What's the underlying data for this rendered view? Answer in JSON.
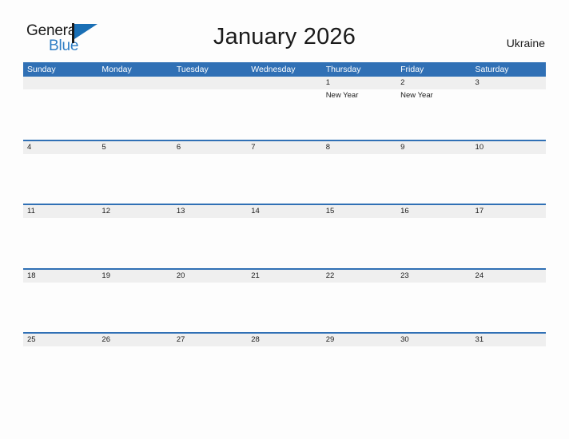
{
  "brand": {
    "name_part1": "General",
    "name_part2": "Blue",
    "logo_icon": "general-blue-flag-logo"
  },
  "header": {
    "title": "January 2026",
    "region": "Ukraine"
  },
  "calendar": {
    "weekdays": [
      "Sunday",
      "Monday",
      "Tuesday",
      "Wednesday",
      "Thursday",
      "Friday",
      "Saturday"
    ],
    "weeks": [
      [
        {
          "date": "",
          "events": []
        },
        {
          "date": "",
          "events": []
        },
        {
          "date": "",
          "events": []
        },
        {
          "date": "",
          "events": []
        },
        {
          "date": "1",
          "events": [
            "New Year"
          ]
        },
        {
          "date": "2",
          "events": [
            "New Year"
          ]
        },
        {
          "date": "3",
          "events": []
        }
      ],
      [
        {
          "date": "4",
          "events": []
        },
        {
          "date": "5",
          "events": []
        },
        {
          "date": "6",
          "events": []
        },
        {
          "date": "7",
          "events": []
        },
        {
          "date": "8",
          "events": []
        },
        {
          "date": "9",
          "events": []
        },
        {
          "date": "10",
          "events": []
        }
      ],
      [
        {
          "date": "11",
          "events": []
        },
        {
          "date": "12",
          "events": []
        },
        {
          "date": "13",
          "events": []
        },
        {
          "date": "14",
          "events": []
        },
        {
          "date": "15",
          "events": []
        },
        {
          "date": "16",
          "events": []
        },
        {
          "date": "17",
          "events": []
        }
      ],
      [
        {
          "date": "18",
          "events": []
        },
        {
          "date": "19",
          "events": []
        },
        {
          "date": "20",
          "events": []
        },
        {
          "date": "21",
          "events": []
        },
        {
          "date": "22",
          "events": []
        },
        {
          "date": "23",
          "events": []
        },
        {
          "date": "24",
          "events": []
        }
      ],
      [
        {
          "date": "25",
          "events": []
        },
        {
          "date": "26",
          "events": []
        },
        {
          "date": "27",
          "events": []
        },
        {
          "date": "28",
          "events": []
        },
        {
          "date": "29",
          "events": []
        },
        {
          "date": "30",
          "events": []
        },
        {
          "date": "31",
          "events": []
        }
      ]
    ]
  },
  "colors": {
    "header_blue": "#3070B5",
    "band_gray": "#EFEFEF",
    "brand_blue": "#2E7DC4",
    "text_dark": "#1B1B1B",
    "page_background": "#FDFDFD"
  }
}
